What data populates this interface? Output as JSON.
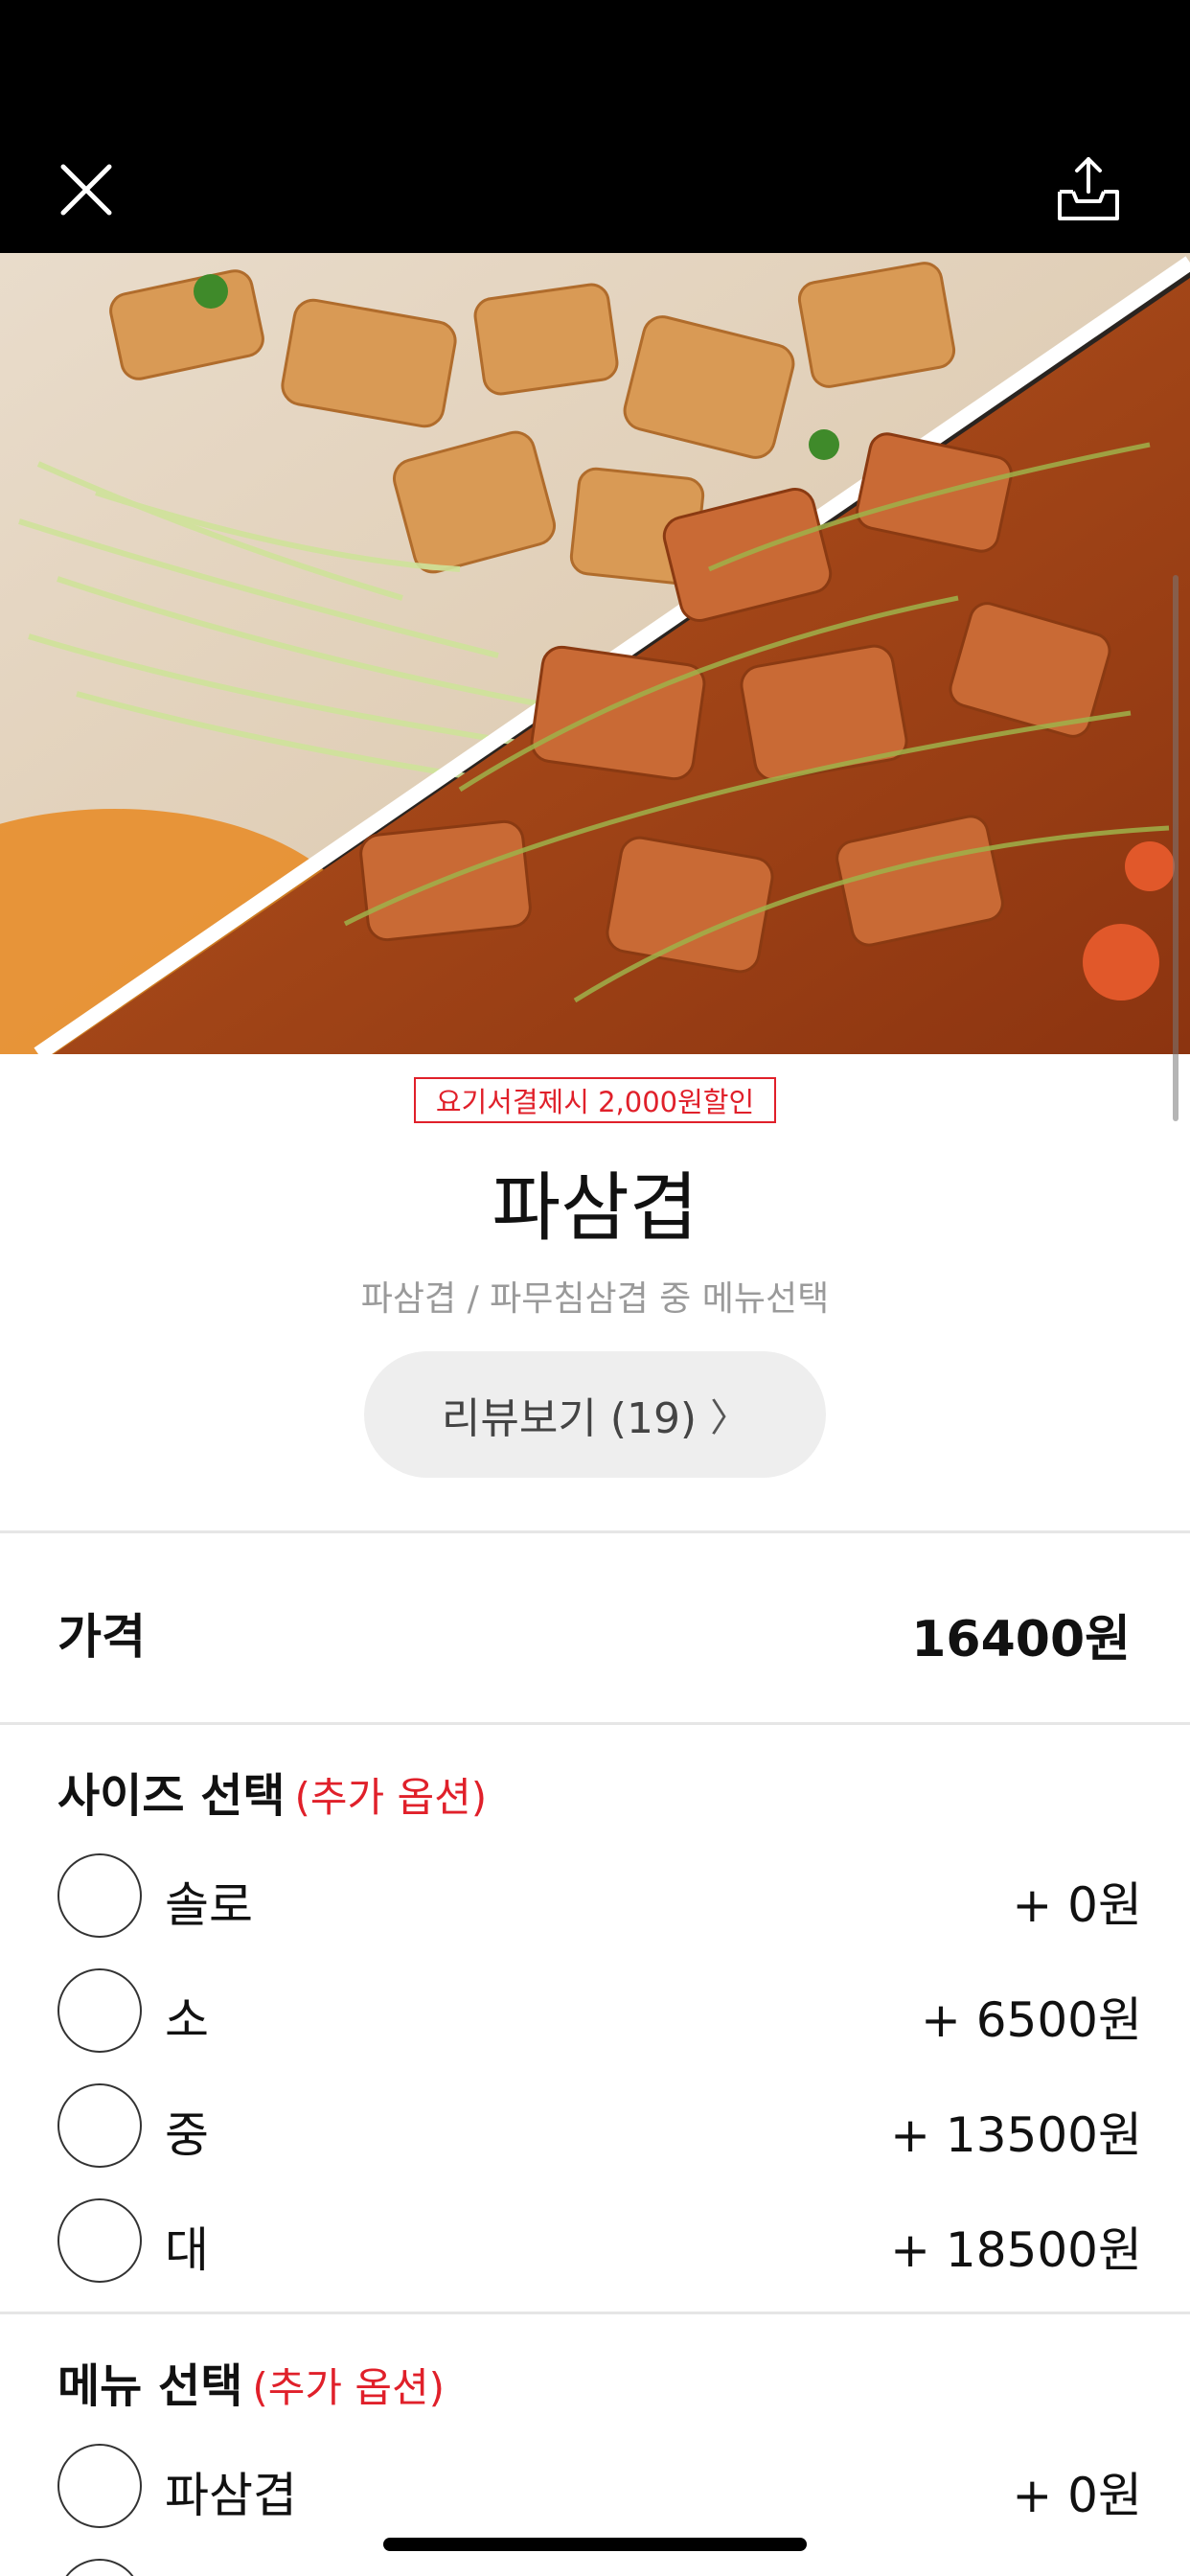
{
  "header": {
    "close_icon": "close-icon",
    "share_icon": "share-icon"
  },
  "hero": {
    "image_desc_icon": "food-photo"
  },
  "product": {
    "discount_badge": "요기서결제시 2,000원할인",
    "name": "파삼겹",
    "description": "파삼겹 / 파무침삼겹 중 메뉴선택",
    "review_button": "리뷰보기 (19)",
    "review_chevron": "〉"
  },
  "price": {
    "label": "가격",
    "value": "16400원"
  },
  "size_section": {
    "title": "사이즈 선택",
    "extra": "(추가 옵션)",
    "options": [
      {
        "label": "솔로",
        "price": "+ 0원"
      },
      {
        "label": "소",
        "price": "+ 6500원"
      },
      {
        "label": "중",
        "price": "+ 13500원"
      },
      {
        "label": "대",
        "price": "+ 18500원"
      }
    ]
  },
  "menu_section": {
    "title": "메뉴 선택",
    "extra": "(추가 옵션)",
    "options": [
      {
        "label": "파삼겹",
        "price": "+ 0원"
      }
    ]
  },
  "colors": {
    "accent_red": "#e0202a",
    "topbar": "#000000"
  }
}
